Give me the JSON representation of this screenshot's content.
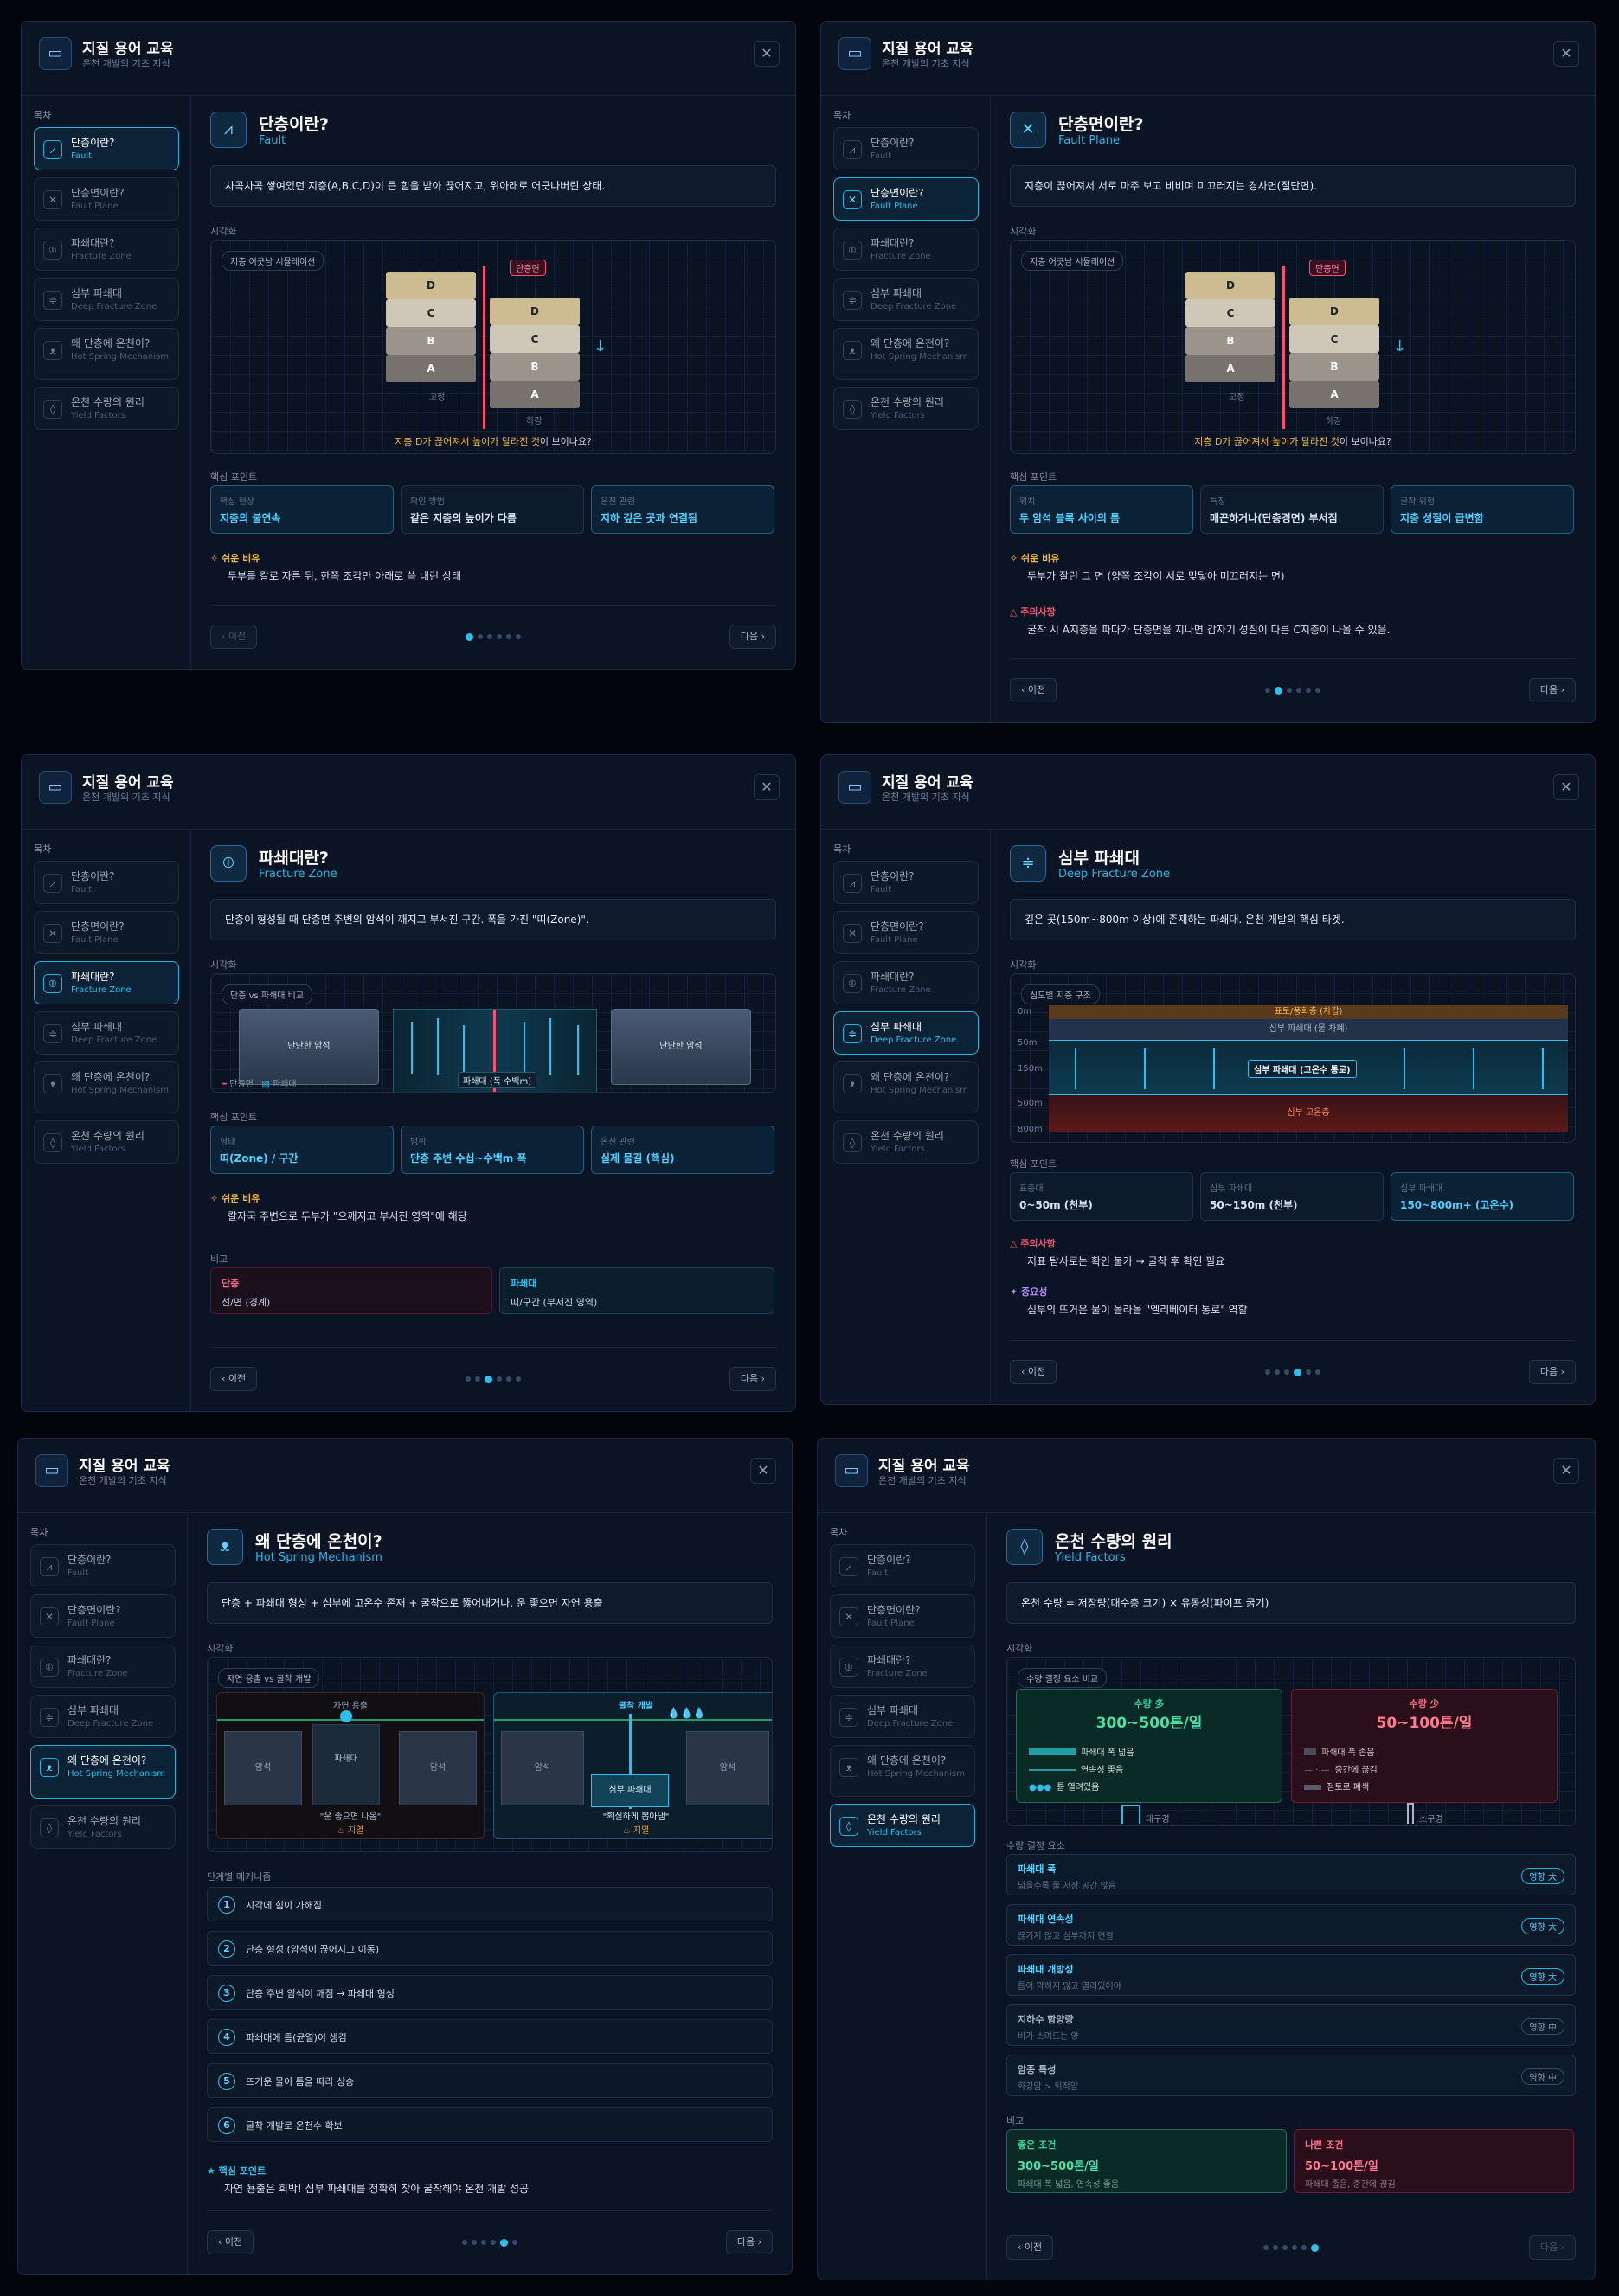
{
  "header": {
    "title": "지질 용어 교육",
    "subtitle": "온천 개발의 기초 지식"
  },
  "sidebar": {
    "toc_label": "목차",
    "items": [
      {
        "ko": "단층이란?",
        "en": "Fault"
      },
      {
        "ko": "단층면이란?",
        "en": "Fault Plane"
      },
      {
        "ko": "파쇄대란?",
        "en": "Fracture Zone"
      },
      {
        "ko": "심부 파쇄대",
        "en": "Deep Fracture Zone"
      },
      {
        "ko": "왜 단층에 온천이?",
        "en": "Hot Spring Mechanism"
      },
      {
        "ko": "온천 수량의 원리",
        "en": "Yield Factors"
      }
    ]
  },
  "labels": {
    "viz": "시각화",
    "key": "핵심 포인트",
    "easy": "쉬운 비유",
    "warn": "주의사항",
    "important": "중요성",
    "compare": "비교",
    "steps": "단계별 메커니즘",
    "core": "핵심 포인트",
    "factors": "수량 결정 요소",
    "prev": "이전",
    "next": "다음"
  },
  "fault": {
    "title": "단층이란?",
    "en": "Fault",
    "def": "차곡차곡 쌓여있던 지층(A,B,C,D)이 큰 힘을 받아 끊어지고, 위아래로 어긋나버린 상태.",
    "viz_tag": "지층 어긋남 시뮬레이션",
    "plane_tag": "단층면",
    "up": "고정",
    "down": "하강",
    "layers": [
      "D",
      "C",
      "B",
      "A"
    ],
    "caption_a": "지층 D가 끊어져서 ",
    "caption_b": "높이가 달라진 것",
    "caption_c": "이 보이나요?",
    "kp": [
      {
        "l": "핵심 현상",
        "v": "지층의 불연속"
      },
      {
        "l": "확인 방법",
        "v": "같은 지층의 높이가 다름"
      },
      {
        "l": "온천 관련",
        "v": "지하 깊은 곳과 연결됨"
      }
    ],
    "easy": "두부를 칼로 자른 뒤, 한쪽 조각만 아래로 쓱 내린 상태"
  },
  "plane": {
    "title": "단층면이란?",
    "en": "Fault Plane",
    "def": "지층이 끊어져서 서로 마주 보고 비비며 미끄러지는 경사면(절단면).",
    "kp": [
      {
        "l": "위치",
        "v": "두 암석 블록 사이의 틈"
      },
      {
        "l": "특징",
        "v": "매끈하거나(단층경면) 부서짐"
      },
      {
        "l": "굴착 위험",
        "v": "지층 성질이 급변함"
      }
    ],
    "easy": "두부가 잘린 그 면 (양쪽 조각이 서로 맞닿아 미끄러지는 면)",
    "warn": "굴착 시 A지층을 파다가 단층면을 지나면 갑자기 성질이 다른 C지층이 나올 수 있음."
  },
  "frac": {
    "title": "파쇄대란?",
    "en": "Fracture Zone",
    "def": "단층이 형성될 때 단층면 주변의 암석이 깨지고 부서진 구간. 폭을 가진 \"띠(Zone)\".",
    "viz_tag": "단층 vs 파쇄대 비교",
    "rock": "단단한 암석",
    "zone": "파쇄대 (폭 수백m)",
    "leg_fault": "단층면",
    "leg_zone": "파쇄대",
    "kp": [
      {
        "l": "형태",
        "v": "띠(Zone) / 구간"
      },
      {
        "l": "범위",
        "v": "단층 주변 수십~수백m 폭"
      },
      {
        "l": "온천 관련",
        "v": "실제 물길 (핵심)"
      }
    ],
    "easy": "칼자국 주변으로 두부가 \"으깨지고 부서진 영역\"에 해당",
    "cmp_a_t": "단층",
    "cmp_a_v": "선/면 (경계)",
    "cmp_b_t": "파쇄대",
    "cmp_b_v": "띠/구간 (부서진 영역)"
  },
  "deep": {
    "title": "심부 파쇄대",
    "en": "Deep Fracture Zone",
    "def": "깊은 곳(150m~800m 이상)에 존재하는 파쇄대. 온천 개발의 핵심 타겟.",
    "viz_tag": "심도별 지층 구조",
    "depths": [
      "0m",
      "50m",
      "150m",
      "500m",
      "800m"
    ],
    "zone_top": "표토/풍화층 (차갑)",
    "zone_shallow": "심부 파쇄대 (물 차폐)",
    "zone_deep": "심부 파쇄대 (고온수 통로)",
    "zone_bottom": "심부 고온층",
    "kp": [
      {
        "l": "표층대",
        "v": "0~50m (천부)"
      },
      {
        "l": "심부 파쇄대",
        "v": "50~150m (천부)"
      },
      {
        "l": "심부 파쇄대",
        "v": "150~800m+ (고온수)"
      }
    ],
    "warn": "지표 탐사로는 확인 불가 → 굴착 후 확인 필요",
    "important": "심부의 뜨거운 물이 올라올 \"엘리베이터 통로\" 역할"
  },
  "mech": {
    "title": "왜 단층에 온천이?",
    "en": "Hot Spring Mechanism",
    "def": "단층 + 파쇄대 형성 + 심부에 고온수 존재 + 굴착으로 뚫어내거나, 운 좋으면 자연 용출",
    "viz_tag": "자연 용출 vs 굴착 개발",
    "nat_top": "자연 용출",
    "nat_rock": "암석",
    "nat_zone": "파쇄대",
    "nat_cap": "\"운 좋으면 나옴\"",
    "nat_heat": "지열",
    "dig_top": "굴착 개발",
    "dig_rock": "암석",
    "dig_zone": "심부 파쇄대",
    "dig_cap": "\"확실하게 뽑아냄\"",
    "dig_heat": "지열",
    "steps": [
      "지각에 힘이 가해짐",
      "단층 형성 (암석이 끊어지고 이동)",
      "단층 주변 암석이 깨짐 → 파쇄대 형성",
      "파쇄대에 틈(균열)이 생김",
      "뜨거운 물이 틈을 따라 상승",
      "굴착 개발로 온천수 확보"
    ],
    "core": "자연 용출은 희박! 심부 파쇄대를 정확히 찾아 굴착해야 온천 개발 성공"
  },
  "yield": {
    "title": "온천 수량의 원리",
    "en": "Yield Factors",
    "def": "온천 수량 = 저장량(대수층 크기) × 유동성(파이프 굵기)",
    "viz_tag": "수량 결정 요소 비교",
    "good_t": "수량 多",
    "good_v": "300~500톤/일",
    "good_items": [
      "파쇄대 폭 넓음",
      "연속성 좋음",
      "틈 열려있음"
    ],
    "good_well": "대구경",
    "bad_t": "수량 少",
    "bad_v": "50~100톤/일",
    "bad_items": [
      "파쇄대 폭 좁음",
      "중간에 끊김",
      "점토로 폐색"
    ],
    "bad_well": "소구경",
    "factors": [
      {
        "t": "파쇄대 폭",
        "s": "넓을수록 물 저장 공간 많음",
        "b": "영향 大",
        "hi": true
      },
      {
        "t": "파쇄대 연속성",
        "s": "끊기지 않고 심부까지 연결",
        "b": "영향 大",
        "hi": true
      },
      {
        "t": "파쇄대 개방성",
        "s": "틈이 막히지 않고 열려있어야",
        "b": "영향 大",
        "hi": true
      },
      {
        "t": "지하수 함양량",
        "s": "비가 스며드는 양",
        "b": "영향 中",
        "hi": false
      },
      {
        "t": "암종 특성",
        "s": "화강암 > 퇴적암",
        "b": "영향 中",
        "hi": false
      }
    ],
    "cmp_a_t": "좋은 조건",
    "cmp_a_v": "300~500톤/일",
    "cmp_a_s": "파쇄대 폭 넓음, 연속성 좋음",
    "cmp_b_t": "나쁜 조건",
    "cmp_b_v": "50~100톤/일",
    "cmp_b_s": "파쇄대 좁음, 중간에 끊김"
  },
  "colors": {
    "accent": "#29c2ef",
    "warn": "#ff4d6d",
    "easy": "#f5b83d",
    "important": "#b58cff",
    "bg": "#0b1424"
  }
}
